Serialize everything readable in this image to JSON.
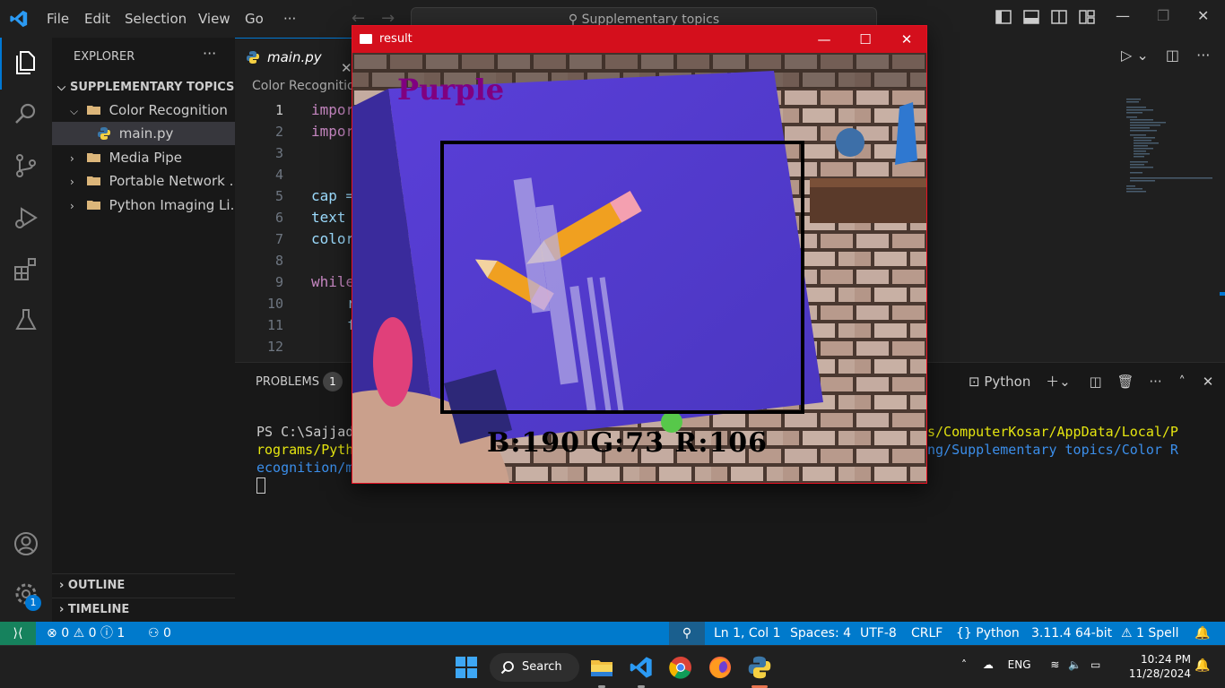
{
  "titlebar": {
    "menu": [
      "File",
      "Edit",
      "Selection",
      "View",
      "Go"
    ],
    "more": "···",
    "search_text": "Supplementary topics",
    "minimize": "—",
    "restore": "❐",
    "close": "✕"
  },
  "sidebar": {
    "title": "EXPLORER",
    "more": "···",
    "root": "SUPPLEMENTARY TOPICS",
    "items": [
      {
        "label": "Color Recognition"
      },
      {
        "label": "main.py"
      },
      {
        "label": "Media Pipe"
      },
      {
        "label": "Portable Network ..."
      },
      {
        "label": "Python Imaging Li..."
      }
    ],
    "outline": "OUTLINE",
    "timeline": "TIMELINE",
    "settings_badge": "1"
  },
  "editor": {
    "tab_label": "main.py",
    "tab_close": "✕",
    "breadcrumb": "Color Recognitio",
    "line_numbers": [
      "1",
      "2",
      "3",
      "4",
      "5",
      "6",
      "7",
      "8",
      "9",
      "10",
      "11",
      "12"
    ],
    "lines": {
      "l1": "impor",
      "l2": "impor",
      "l5": "cap =",
      "l6": "text ",
      "l7": "color",
      "l9": "while",
      "l10": "r",
      "l11": "f"
    }
  },
  "panel": {
    "problems_label": "PROBLEMS",
    "problems_count": "1",
    "terminal_label": "Python",
    "terminal": {
      "line1_left": "PS C:\\Sajjad",
      "line1_right": "s/ComputerKosar/AppData/Local/P",
      "line2_left": "rograms/Pyth",
      "line2_right": "ng/Supplementary topics/Color R",
      "line3_left": "ecognition/m"
    }
  },
  "statusbar": {
    "errors": "0",
    "warnings": "0",
    "infos": "1",
    "ports": "0",
    "position": "Ln 1, Col 1",
    "spaces": "Spaces: 4",
    "encoding": "UTF-8",
    "eol": "CRLF",
    "language": "Python",
    "interpreter": "3.11.4 64-bit",
    "spell": "1 Spell"
  },
  "taskbar": {
    "search_label": "Search",
    "language": "ENG",
    "time": "10:24 PM",
    "date": "11/28/2024"
  },
  "result_window": {
    "title": "result",
    "minimize": "—",
    "maximize": "☐",
    "close": "✕",
    "color_name": "Purple",
    "bgr_text": "B:190 G:73 R:106"
  },
  "colors": {
    "accent": "#0078d4",
    "statusbar": "#007acc",
    "result_titlebar": "#d40f1c",
    "color_label": "#800080"
  }
}
